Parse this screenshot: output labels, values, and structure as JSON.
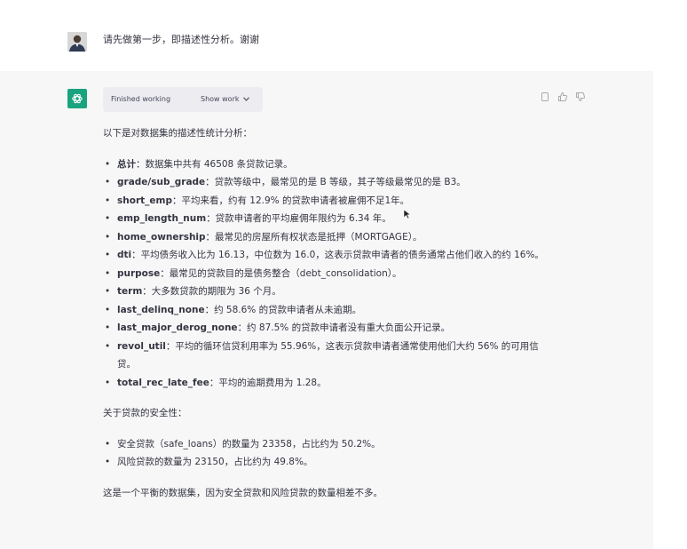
{
  "user": {
    "avatar": "user-avatar-photo",
    "message": "请先做第一步，即描述性分析。谢谢"
  },
  "assistant": {
    "avatar_icon": "openai-logo-icon",
    "status": "Finished working",
    "show_work": "Show work",
    "intro": "以下是对数据集的描述性统计分析：",
    "items": [
      {
        "key": "总计",
        "text": "：数据集中共有 46508 条贷款记录。"
      },
      {
        "key": "grade/sub_grade",
        "text": "：贷款等级中，最常见的是 B 等级，其子等级最常见的是 B3。"
      },
      {
        "key": "short_emp",
        "text": "：平均来看，约有 12.9% 的贷款申请者被雇佣不足1年。"
      },
      {
        "key": "emp_length_num",
        "text": "：贷款申请者的平均雇佣年限约为 6.34 年。"
      },
      {
        "key": "home_ownership",
        "text": "：最常见的房屋所有权状态是抵押（MORTGAGE）。"
      },
      {
        "key": "dti",
        "text": "：平均债务收入比为 16.13，中位数为 16.0，这表示贷款申请者的债务通常占他们收入的约 16%。"
      },
      {
        "key": "purpose",
        "text": "：最常见的贷款目的是债务整合（debt_consolidation）。"
      },
      {
        "key": "term",
        "text": "：大多数贷款的期限为 36 个月。"
      },
      {
        "key": "last_delinq_none",
        "text": "：约 58.6% 的贷款申请者从未逾期。"
      },
      {
        "key": "last_major_derog_none",
        "text": "：约 87.5% 的贷款申请者没有重大负面公开记录。"
      },
      {
        "key": "revol_util",
        "text": "：平均的循环信贷利用率为 55.96%，这表示贷款申请者通常使用他们大约 56% 的可用信贷。"
      },
      {
        "key": "total_rec_late_fee",
        "text": "：平均的逾期费用为 1.28。"
      }
    ],
    "safety_title": "关于贷款的安全性：",
    "safety_items": [
      "安全贷款（safe_loans）的数量为 23358，占比约为 50.2%。",
      "风险贷款的数量为 23150，占比约为 49.8%。"
    ],
    "conclusion": "这是一个平衡的数据集，因为安全贷款和风险贷款的数量相差不多。"
  },
  "actions": [
    "copy-icon",
    "thumbs-up-icon",
    "thumbs-down-icon"
  ]
}
